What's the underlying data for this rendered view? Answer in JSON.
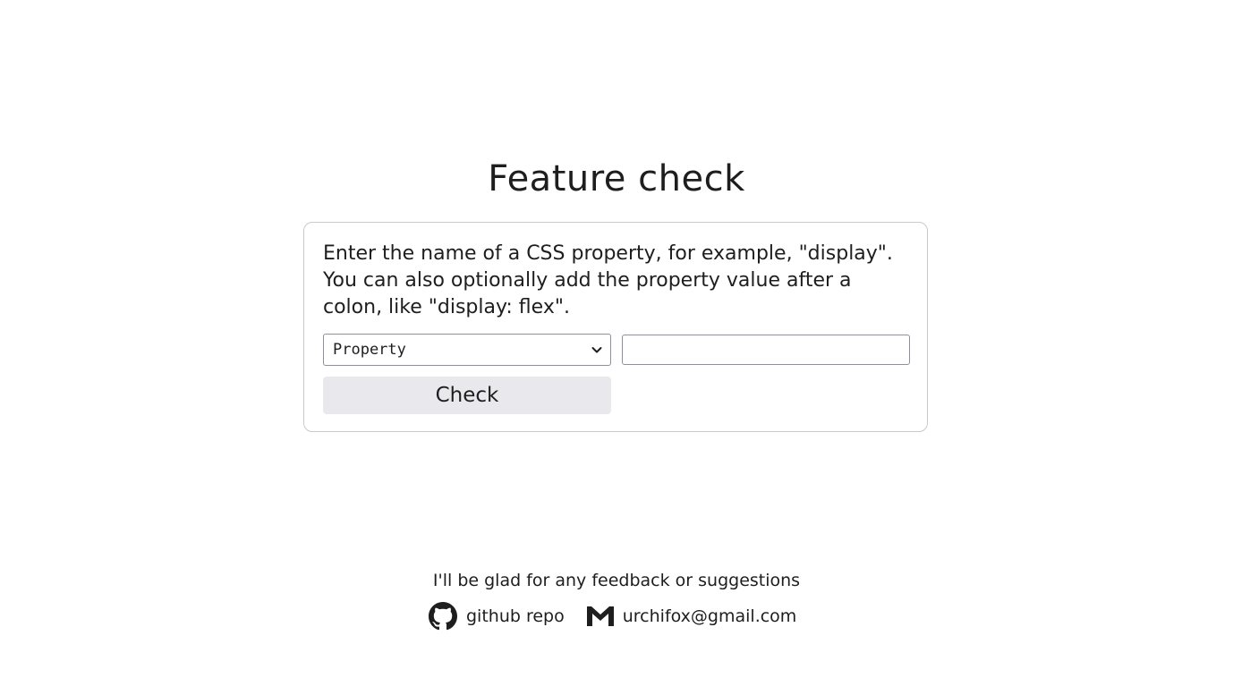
{
  "page": {
    "title": "Feature check"
  },
  "form": {
    "description": "Enter the name of a CSS property, for example, \"display\". You can also optionally add the property value after a colon, like \"display: flex\".",
    "mode_select": {
      "selected": "Property"
    },
    "query_input": {
      "value": "",
      "placeholder": ""
    },
    "check_button": "Check"
  },
  "footer": {
    "feedback_text": "I'll be glad for any feedback or suggestions",
    "github_link": {
      "label": "github repo",
      "icon": "github-icon"
    },
    "email_link": {
      "label": "urchifox@gmail.com",
      "icon": "gmail-icon"
    }
  }
}
